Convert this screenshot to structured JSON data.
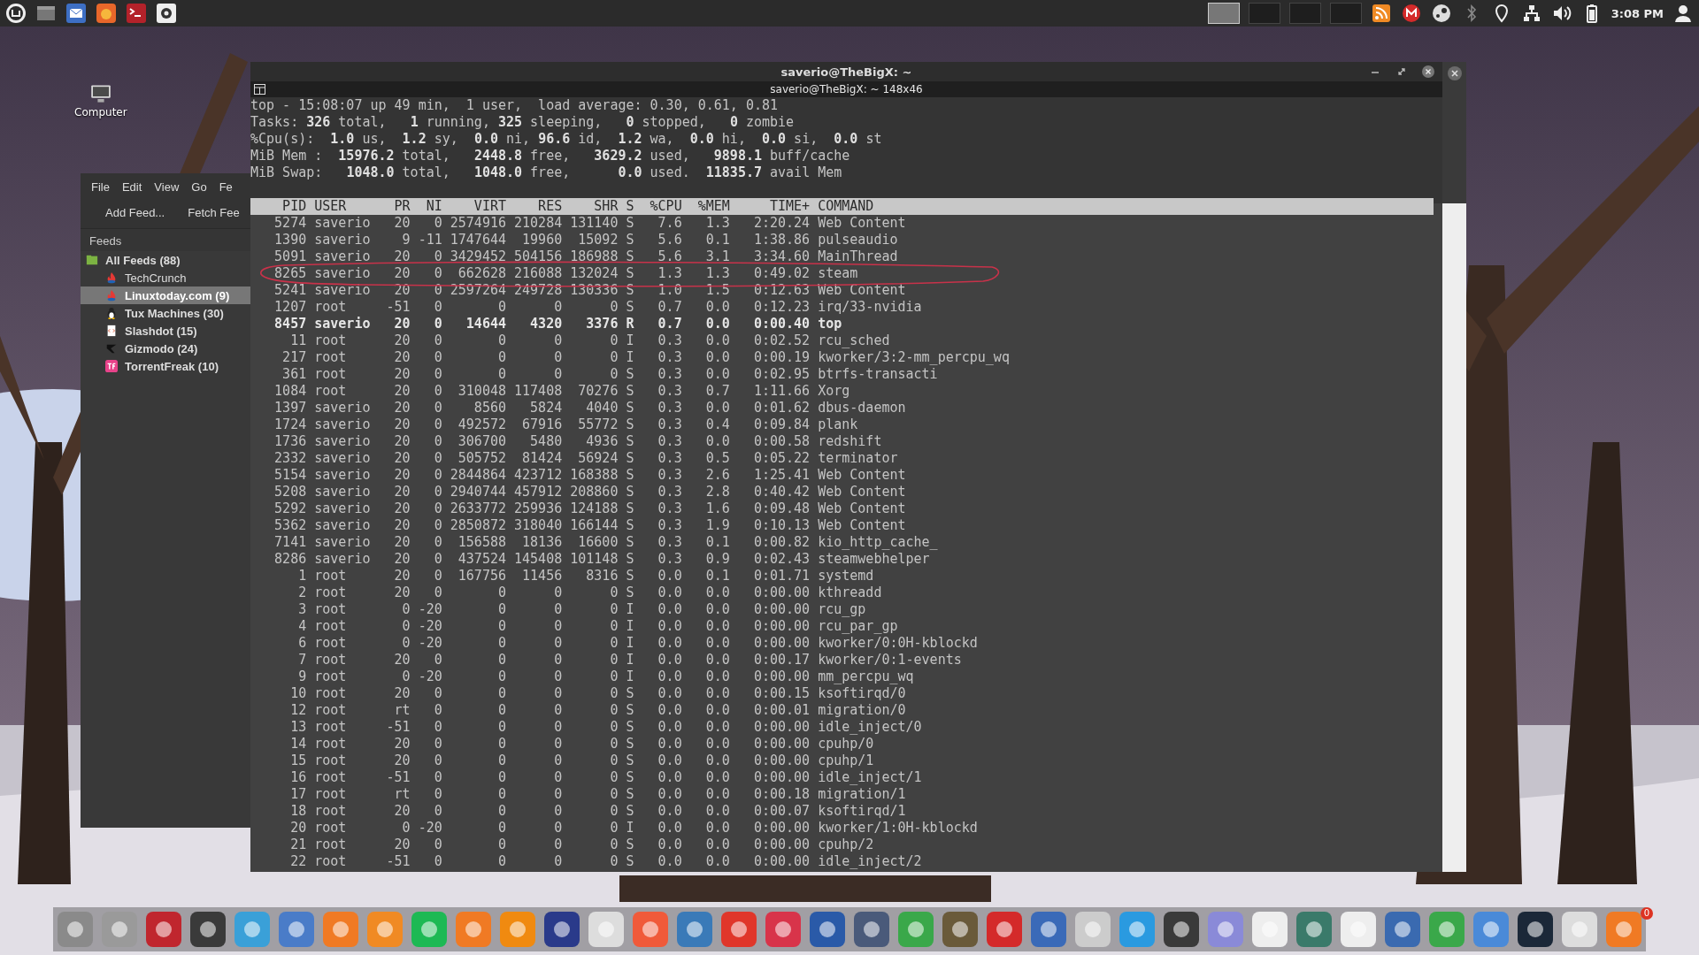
{
  "panel": {
    "clock": "3:08 PM"
  },
  "desktop_icons": [
    {
      "label": "Computer"
    }
  ],
  "feed_reader": {
    "menu": [
      "File",
      "Edit",
      "View",
      "Go",
      "Fe"
    ],
    "toolbar": [
      "Add Feed...",
      "Fetch Fee"
    ],
    "header": "Feeds",
    "tree": [
      {
        "label": "All Feeds (88)",
        "unread": true,
        "selected": false,
        "children": [
          {
            "label": "TechCrunch",
            "unread": false,
            "selected": false
          },
          {
            "label": "Linuxtoday.com (9)",
            "unread": true,
            "selected": true
          },
          {
            "label": "Tux Machines (30)",
            "unread": true,
            "selected": false
          },
          {
            "label": "Slashdot (15)",
            "unread": true,
            "selected": false
          },
          {
            "label": "Gizmodo (24)",
            "unread": true,
            "selected": false
          },
          {
            "label": "TorrentFreak (10)",
            "unread": true,
            "selected": false
          }
        ]
      }
    ]
  },
  "terminal": {
    "title": "saverio@TheBigX: ~",
    "subtitle": "saverio@TheBigX: ~ 148x46",
    "summary": [
      "top - 15:08:07 up 49 min,  1 user,  load average: 0.30, 0.61, 0.81",
      "Tasks: **326** total,   **1** running, **325** sleeping,   **0** stopped,   **0** zombie",
      "%Cpu(s):  **1.0** us,  **1.2** sy,  **0.0** ni, **96.6** id,  **1.2** wa,  **0.0** hi,  **0.0** si,  **0.0** st",
      "MiB Mem :  **15976.2** total,   **2448.8** free,   **3629.2** used,   **9898.1** buff/cache",
      "MiB Swap:   **1048.0** total,   **1048.0** free,      **0.0** used.  **11835.7** avail Mem"
    ],
    "columns": [
      "PID",
      "USER",
      "PR",
      "NI",
      "VIRT",
      "RES",
      "SHR",
      "S",
      "%CPU",
      "%MEM",
      "TIME+",
      "COMMAND"
    ],
    "processes": [
      {
        "fields": [
          "5274",
          "saverio",
          "20",
          "0",
          "2574916",
          "210284",
          "131140",
          "S",
          "7.6",
          "1.3",
          "2:20.24",
          "Web Content"
        ],
        "running": false,
        "circled": false
      },
      {
        "fields": [
          "1390",
          "saverio",
          "9",
          "-11",
          "1747644",
          "19960",
          "15092",
          "S",
          "5.6",
          "0.1",
          "1:38.86",
          "pulseaudio"
        ],
        "running": false,
        "circled": false
      },
      {
        "fields": [
          "5091",
          "saverio",
          "20",
          "0",
          "3429452",
          "504156",
          "186988",
          "S",
          "5.6",
          "3.1",
          "3:34.60",
          "MainThread"
        ],
        "running": false,
        "circled": false
      },
      {
        "fields": [
          "8265",
          "saverio",
          "20",
          "0",
          "662628",
          "216088",
          "132024",
          "S",
          "1.3",
          "1.3",
          "0:49.02",
          "steam"
        ],
        "running": false,
        "circled": true
      },
      {
        "fields": [
          "5241",
          "saverio",
          "20",
          "0",
          "2597264",
          "249728",
          "130336",
          "S",
          "1.0",
          "1.5",
          "0:12.63",
          "Web Content"
        ],
        "running": false,
        "circled": false
      },
      {
        "fields": [
          "1207",
          "root",
          "-51",
          "0",
          "0",
          "0",
          "0",
          "S",
          "0.7",
          "0.0",
          "0:12.23",
          "irq/33-nvidia"
        ],
        "running": false,
        "circled": false
      },
      {
        "fields": [
          "8457",
          "saverio",
          "20",
          "0",
          "14644",
          "4320",
          "3376",
          "R",
          "0.7",
          "0.0",
          "0:00.40",
          "top"
        ],
        "running": true,
        "circled": false
      },
      {
        "fields": [
          "11",
          "root",
          "20",
          "0",
          "0",
          "0",
          "0",
          "I",
          "0.3",
          "0.0",
          "0:02.52",
          "rcu_sched"
        ],
        "running": false,
        "circled": false
      },
      {
        "fields": [
          "217",
          "root",
          "20",
          "0",
          "0",
          "0",
          "0",
          "I",
          "0.3",
          "0.0",
          "0:00.19",
          "kworker/3:2-mm_percpu_wq"
        ],
        "running": false,
        "circled": false
      },
      {
        "fields": [
          "361",
          "root",
          "20",
          "0",
          "0",
          "0",
          "0",
          "S",
          "0.3",
          "0.0",
          "0:02.95",
          "btrfs-transacti"
        ],
        "running": false,
        "circled": false
      },
      {
        "fields": [
          "1084",
          "root",
          "20",
          "0",
          "310048",
          "117408",
          "70276",
          "S",
          "0.3",
          "0.7",
          "1:11.66",
          "Xorg"
        ],
        "running": false,
        "circled": false
      },
      {
        "fields": [
          "1397",
          "saverio",
          "20",
          "0",
          "8560",
          "5824",
          "4040",
          "S",
          "0.3",
          "0.0",
          "0:01.62",
          "dbus-daemon"
        ],
        "running": false,
        "circled": false
      },
      {
        "fields": [
          "1724",
          "saverio",
          "20",
          "0",
          "492572",
          "67916",
          "55772",
          "S",
          "0.3",
          "0.4",
          "0:09.84",
          "plank"
        ],
        "running": false,
        "circled": false
      },
      {
        "fields": [
          "1736",
          "saverio",
          "20",
          "0",
          "306700",
          "5480",
          "4936",
          "S",
          "0.3",
          "0.0",
          "0:00.58",
          "redshift"
        ],
        "running": false,
        "circled": false
      },
      {
        "fields": [
          "2332",
          "saverio",
          "20",
          "0",
          "505752",
          "81424",
          "56924",
          "S",
          "0.3",
          "0.5",
          "0:05.22",
          "terminator"
        ],
        "running": false,
        "circled": false
      },
      {
        "fields": [
          "5154",
          "saverio",
          "20",
          "0",
          "2844864",
          "423712",
          "168388",
          "S",
          "0.3",
          "2.6",
          "1:25.41",
          "Web Content"
        ],
        "running": false,
        "circled": false
      },
      {
        "fields": [
          "5208",
          "saverio",
          "20",
          "0",
          "2940744",
          "457912",
          "208860",
          "S",
          "0.3",
          "2.8",
          "0:40.42",
          "Web Content"
        ],
        "running": false,
        "circled": false
      },
      {
        "fields": [
          "5292",
          "saverio",
          "20",
          "0",
          "2633772",
          "259936",
          "124188",
          "S",
          "0.3",
          "1.6",
          "0:09.48",
          "Web Content"
        ],
        "running": false,
        "circled": false
      },
      {
        "fields": [
          "5362",
          "saverio",
          "20",
          "0",
          "2850872",
          "318040",
          "166144",
          "S",
          "0.3",
          "1.9",
          "0:10.13",
          "Web Content"
        ],
        "running": false,
        "circled": false
      },
      {
        "fields": [
          "7141",
          "saverio",
          "20",
          "0",
          "156588",
          "18136",
          "16600",
          "S",
          "0.3",
          "0.1",
          "0:00.82",
          "kio_http_cache_"
        ],
        "running": false,
        "circled": false
      },
      {
        "fields": [
          "8286",
          "saverio",
          "20",
          "0",
          "437524",
          "145408",
          "101148",
          "S",
          "0.3",
          "0.9",
          "0:02.43",
          "steamwebhelper"
        ],
        "running": false,
        "circled": false
      },
      {
        "fields": [
          "1",
          "root",
          "20",
          "0",
          "167756",
          "11456",
          "8316",
          "S",
          "0.0",
          "0.1",
          "0:01.71",
          "systemd"
        ],
        "running": false,
        "circled": false
      },
      {
        "fields": [
          "2",
          "root",
          "20",
          "0",
          "0",
          "0",
          "0",
          "S",
          "0.0",
          "0.0",
          "0:00.00",
          "kthreadd"
        ],
        "running": false,
        "circled": false
      },
      {
        "fields": [
          "3",
          "root",
          "0",
          "-20",
          "0",
          "0",
          "0",
          "I",
          "0.0",
          "0.0",
          "0:00.00",
          "rcu_gp"
        ],
        "running": false,
        "circled": false
      },
      {
        "fields": [
          "4",
          "root",
          "0",
          "-20",
          "0",
          "0",
          "0",
          "I",
          "0.0",
          "0.0",
          "0:00.00",
          "rcu_par_gp"
        ],
        "running": false,
        "circled": false
      },
      {
        "fields": [
          "6",
          "root",
          "0",
          "-20",
          "0",
          "0",
          "0",
          "I",
          "0.0",
          "0.0",
          "0:00.00",
          "kworker/0:0H-kblockd"
        ],
        "running": false,
        "circled": false
      },
      {
        "fields": [
          "7",
          "root",
          "20",
          "0",
          "0",
          "0",
          "0",
          "I",
          "0.0",
          "0.0",
          "0:00.17",
          "kworker/0:1-events"
        ],
        "running": false,
        "circled": false
      },
      {
        "fields": [
          "9",
          "root",
          "0",
          "-20",
          "0",
          "0",
          "0",
          "I",
          "0.0",
          "0.0",
          "0:00.00",
          "mm_percpu_wq"
        ],
        "running": false,
        "circled": false
      },
      {
        "fields": [
          "10",
          "root",
          "20",
          "0",
          "0",
          "0",
          "0",
          "S",
          "0.0",
          "0.0",
          "0:00.15",
          "ksoftirqd/0"
        ],
        "running": false,
        "circled": false
      },
      {
        "fields": [
          "12",
          "root",
          "rt",
          "0",
          "0",
          "0",
          "0",
          "S",
          "0.0",
          "0.0",
          "0:00.01",
          "migration/0"
        ],
        "running": false,
        "circled": false
      },
      {
        "fields": [
          "13",
          "root",
          "-51",
          "0",
          "0",
          "0",
          "0",
          "S",
          "0.0",
          "0.0",
          "0:00.00",
          "idle_inject/0"
        ],
        "running": false,
        "circled": false
      },
      {
        "fields": [
          "14",
          "root",
          "20",
          "0",
          "0",
          "0",
          "0",
          "S",
          "0.0",
          "0.0",
          "0:00.00",
          "cpuhp/0"
        ],
        "running": false,
        "circled": false
      },
      {
        "fields": [
          "15",
          "root",
          "20",
          "0",
          "0",
          "0",
          "0",
          "S",
          "0.0",
          "0.0",
          "0:00.00",
          "cpuhp/1"
        ],
        "running": false,
        "circled": false
      },
      {
        "fields": [
          "16",
          "root",
          "-51",
          "0",
          "0",
          "0",
          "0",
          "S",
          "0.0",
          "0.0",
          "0:00.00",
          "idle_inject/1"
        ],
        "running": false,
        "circled": false
      },
      {
        "fields": [
          "17",
          "root",
          "rt",
          "0",
          "0",
          "0",
          "0",
          "S",
          "0.0",
          "0.0",
          "0:00.18",
          "migration/1"
        ],
        "running": false,
        "circled": false
      },
      {
        "fields": [
          "18",
          "root",
          "20",
          "0",
          "0",
          "0",
          "0",
          "S",
          "0.0",
          "0.0",
          "0:00.07",
          "ksoftirqd/1"
        ],
        "running": false,
        "circled": false
      },
      {
        "fields": [
          "20",
          "root",
          "0",
          "-20",
          "0",
          "0",
          "0",
          "I",
          "0.0",
          "0.0",
          "0:00.00",
          "kworker/1:0H-kblockd"
        ],
        "running": false,
        "circled": false
      },
      {
        "fields": [
          "21",
          "root",
          "20",
          "0",
          "0",
          "0",
          "0",
          "S",
          "0.0",
          "0.0",
          "0:00.00",
          "cpuhp/2"
        ],
        "running": false,
        "circled": false
      },
      {
        "fields": [
          "22",
          "root",
          "-51",
          "0",
          "0",
          "0",
          "0",
          "S",
          "0.0",
          "0.0",
          "0:00.00",
          "idle_inject/2"
        ],
        "running": false,
        "circled": false
      }
    ]
  },
  "dock": {
    "badge": "0"
  }
}
